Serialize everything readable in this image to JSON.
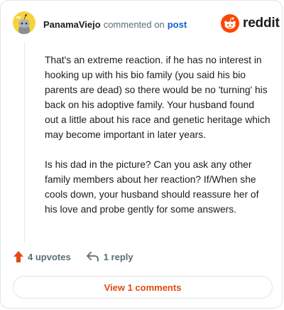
{
  "header": {
    "username": "PanamaViejo",
    "action": "commented on",
    "post_link": "post",
    "brand": "reddit"
  },
  "icons": {
    "avatar": "snoo-avatar-icon",
    "brand_logo": "reddit-snoo-icon",
    "upvote": "upvote-arrow-icon",
    "reply": "reply-arrow-icon"
  },
  "colors": {
    "brand": "#ff4500",
    "upvote": "#e24a12",
    "link": "#1160d2",
    "view_comments": "#e24a12"
  },
  "comment": {
    "paragraphs": [
      "That's an extreme reaction. if he has no interest in hooking up with his bio family (you said his bio parents are dead) so there would be no 'turning' his back on his adoptive family. Your husband found out a little about his race and genetic heritage which may become important in later years.",
      "Is his dad in the picture? Can you ask any other family members about her reaction? If/When she cools down, your husband should reassure her of his love and probe gently for some answers."
    ]
  },
  "actions": {
    "upvotes": "4 upvotes",
    "replies": "1 reply"
  },
  "footer": {
    "view_comments": "View 1 comments"
  }
}
